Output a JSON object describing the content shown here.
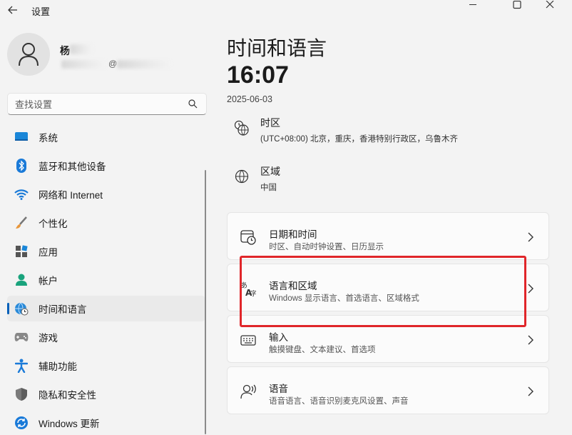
{
  "window": {
    "title": "设置"
  },
  "account": {
    "name": "杨",
    "email": "@"
  },
  "search": {
    "placeholder": "查找设置"
  },
  "sidebar": {
    "items": [
      {
        "label": "系统",
        "icon": "monitor-icon",
        "active": false
      },
      {
        "label": "蓝牙和其他设备",
        "icon": "bluetooth-icon",
        "active": false
      },
      {
        "label": "网络和 Internet",
        "icon": "wifi-icon",
        "active": false
      },
      {
        "label": "个性化",
        "icon": "brush-icon",
        "active": false
      },
      {
        "label": "应用",
        "icon": "apps-icon",
        "active": false
      },
      {
        "label": "帐户",
        "icon": "person-icon",
        "active": false
      },
      {
        "label": "时间和语言",
        "icon": "globe-clock-icon",
        "active": true
      },
      {
        "label": "游戏",
        "icon": "gamepad-icon",
        "active": false
      },
      {
        "label": "辅助功能",
        "icon": "accessibility-icon",
        "active": false
      },
      {
        "label": "隐私和安全性",
        "icon": "shield-icon",
        "active": false
      },
      {
        "label": "Windows 更新",
        "icon": "update-icon",
        "active": false
      }
    ]
  },
  "main": {
    "title": "时间和语言",
    "clock": "16:07",
    "date": "2025-06-03",
    "timezone": {
      "title": "时区",
      "value": "(UTC+08:00) 北京，重庆，香港特别行政区，乌鲁木齐"
    },
    "region": {
      "title": "区域",
      "value": "中国"
    },
    "cards": [
      {
        "title": "日期和时间",
        "sub": "时区、自动时钟设置、日历显示",
        "icon": "calendar-clock-icon"
      },
      {
        "title": "语言和区域",
        "sub": "Windows 显示语言、首选语言、区域格式",
        "icon": "language-icon"
      },
      {
        "title": "输入",
        "sub": "触摸键盘、文本建议、首选项",
        "icon": "keyboard-icon"
      },
      {
        "title": "语音",
        "sub": "语音语言、语音识别麦克风设置、声音",
        "icon": "speech-icon"
      }
    ]
  },
  "colors": {
    "accent": "#005fb8",
    "highlight": "#e0262a",
    "background": "#f3f3f3",
    "card": "#fbfbfb"
  }
}
